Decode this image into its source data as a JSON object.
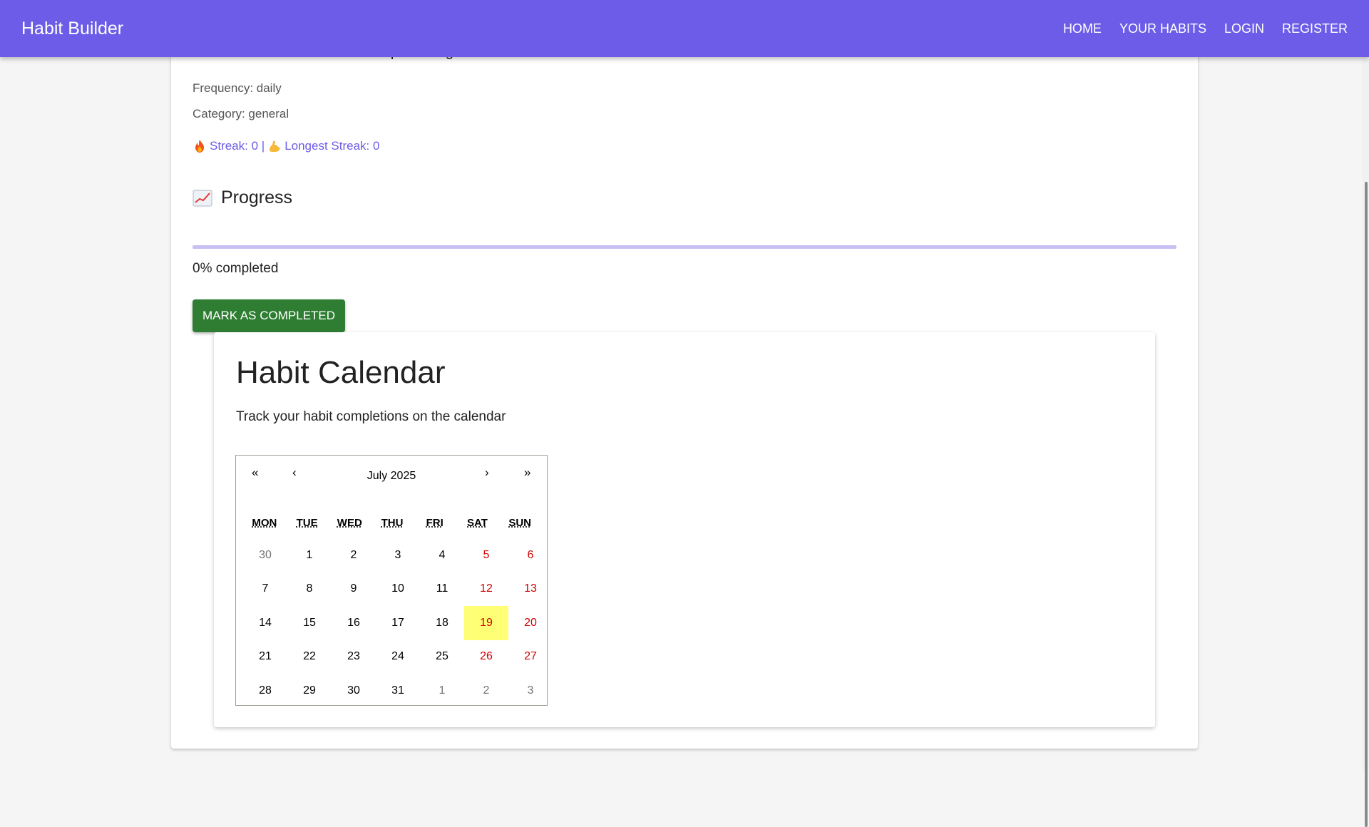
{
  "header": {
    "brand": "Habit Builder",
    "nav": [
      "HOME",
      "YOUR HABITS",
      "LOGIN",
      "REGISTER"
    ],
    "color": "#6c5ce7"
  },
  "habit": {
    "title": "MERN Stack Summer Internship/Training Course",
    "frequency": "Frequency: daily",
    "category": "Category: general",
    "streak": "Streak: 0 |",
    "longest_streak": "Longest Streak: 0",
    "streak_icon": "fire-icon",
    "longest_icon": "flexed-bicep-icon"
  },
  "progress": {
    "icon": "chart-increasing-icon",
    "title": "Progress",
    "percent_label": "0% completed",
    "fraction": 0,
    "button_label": "MARK AS COMPLETED",
    "button_color": "#2e7d32"
  },
  "calendar": {
    "title": "Habit Calendar",
    "subtitle": "Track your habit completions on the calendar",
    "month_label": "July 2025",
    "prev2": "«",
    "prev": "‹",
    "next": "›",
    "next2": "»",
    "weekdays": [
      "MON",
      "TUE",
      "WED",
      "THU",
      "FRI",
      "SAT",
      "SUN"
    ],
    "days": [
      {
        "d": "30",
        "type": "neighbor"
      },
      {
        "d": "1"
      },
      {
        "d": "2"
      },
      {
        "d": "3"
      },
      {
        "d": "4"
      },
      {
        "d": "5",
        "type": "weekend"
      },
      {
        "d": "6",
        "type": "weekend"
      },
      {
        "d": "7"
      },
      {
        "d": "8"
      },
      {
        "d": "9"
      },
      {
        "d": "10"
      },
      {
        "d": "11"
      },
      {
        "d": "12",
        "type": "weekend"
      },
      {
        "d": "13",
        "type": "weekend"
      },
      {
        "d": "14"
      },
      {
        "d": "15"
      },
      {
        "d": "16"
      },
      {
        "d": "17"
      },
      {
        "d": "18"
      },
      {
        "d": "19",
        "type": "weekend",
        "today": true
      },
      {
        "d": "20",
        "type": "weekend"
      },
      {
        "d": "21"
      },
      {
        "d": "22"
      },
      {
        "d": "23"
      },
      {
        "d": "24"
      },
      {
        "d": "25"
      },
      {
        "d": "26",
        "type": "weekend"
      },
      {
        "d": "27",
        "type": "weekend"
      },
      {
        "d": "28"
      },
      {
        "d": "29"
      },
      {
        "d": "30"
      },
      {
        "d": "31"
      },
      {
        "d": "1",
        "type": "neighbor"
      },
      {
        "d": "2",
        "type": "neighbor"
      },
      {
        "d": "3",
        "type": "neighbor"
      }
    ],
    "today_color": "#ffff76"
  }
}
